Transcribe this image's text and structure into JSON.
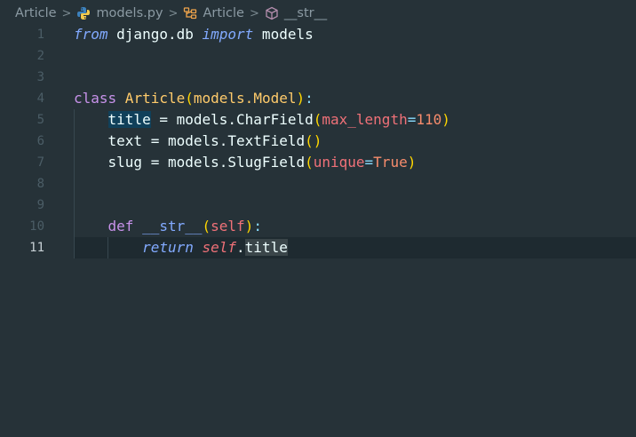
{
  "breadcrumb": {
    "items": [
      {
        "label": "Article",
        "icon": "none"
      },
      {
        "label": "models.py",
        "icon": "python-icon"
      },
      {
        "label": "Article",
        "icon": "class-icon"
      },
      {
        "label": "__str__",
        "icon": "method-icon"
      }
    ],
    "separator": ">"
  },
  "editor": {
    "active_line": 11,
    "line_numbers": [
      "1",
      "2",
      "3",
      "4",
      "5",
      "6",
      "7",
      "8",
      "9",
      "10",
      "11"
    ],
    "lines": {
      "l1": {
        "from": "from",
        "module": " django.db ",
        "import": "import",
        "name": " models"
      },
      "l4": {
        "class": "class",
        "name": " Article",
        "open": "(",
        "base_mod": "models.",
        "base": "Model",
        "close": ")",
        "colon": ":"
      },
      "l5": {
        "indent": "    ",
        "var": "title",
        "eq": " = ",
        "call": "models.CharField",
        "open": "(",
        "param": "max_length",
        "op": "=",
        "value": "110",
        "close": ")"
      },
      "l6": {
        "indent": "    ",
        "var": "text",
        "eq": " = ",
        "call": "models.TextField",
        "open": "(",
        "close": ")"
      },
      "l7": {
        "indent": "    ",
        "var": "slug",
        "eq": " = ",
        "call": "models.SlugField",
        "open": "(",
        "param": "unique",
        "op": "=",
        "value": "True",
        "close": ")"
      },
      "l10": {
        "indent": "    ",
        "def": "def",
        "name": " __str__",
        "open": "(",
        "param": "self",
        "close": ")",
        "colon": ":"
      },
      "l11": {
        "indent": "        ",
        "return": "return",
        "self": " self",
        "dot": ".",
        "attr": "title"
      }
    }
  },
  "colors": {
    "background": "#263238",
    "keyword": "#c792ea",
    "class_name": "#ffcb6b",
    "parameter": "#f07178",
    "number": "#f78c6c",
    "function": "#82aaff"
  }
}
